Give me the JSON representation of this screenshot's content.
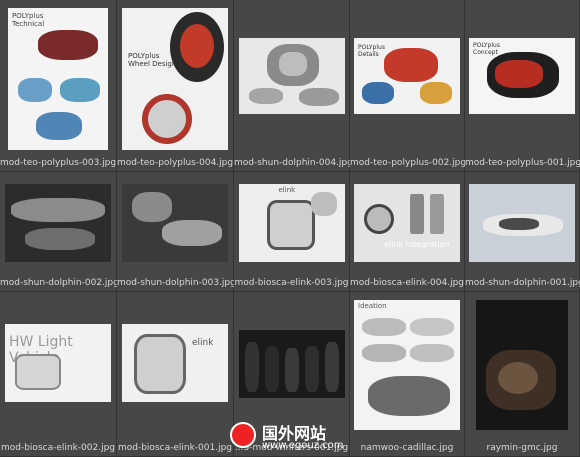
{
  "files": [
    {
      "name": "mod-teo-polyplus-003.jpg",
      "title": "POLYplus Technical",
      "accent": "#d8352a"
    },
    {
      "name": "mod-teo-polyplus-004.jpg",
      "title": "POLYplus Wheel Design",
      "accent": "#c23a28"
    },
    {
      "name": "mod-shun-dolphin-004.jpg",
      "title": "",
      "accent": "#8a8a8a"
    },
    {
      "name": "mod-teo-polyplus-002.jpg",
      "title": "POLYplus Details",
      "accent": "#c33a2a"
    },
    {
      "name": "mod-teo-polyplus-001.jpg",
      "title": "POLYplus Concept",
      "accent": "#b82d22"
    },
    {
      "name": "mod-shun-dolphin-002.jpg",
      "title": "",
      "accent": "#777777"
    },
    {
      "name": "mod-shun-dolphin-003.jpg",
      "title": "",
      "accent": "#7b7b7b"
    },
    {
      "name": "mod-biosca-elink-003.jpg",
      "title": "elink",
      "accent": "#555555"
    },
    {
      "name": "mod-biosca-elink-004.jpg",
      "title": "elink Integration",
      "accent": "#555555"
    },
    {
      "name": "mod-shun-dolphin-001.jpg",
      "title": "",
      "accent": "#9aa3ad"
    },
    {
      "name": "mod-biosca-elink-002.jpg",
      "title": "HW Light Vehicle",
      "accent": "#999999"
    },
    {
      "name": "mod-biosca-elink-001.jpg",
      "title": "elink",
      "accent": "#666666"
    },
    {
      "name": "...3-mod-winners-001.jpg",
      "title": "",
      "accent": "#1a1a1a"
    },
    {
      "name": "namwoo-cadillac.jpg",
      "title": "Ideation",
      "accent": "#666666"
    },
    {
      "name": "raymin-gmc.jpg",
      "title": "",
      "accent": "#1c1c1c"
    }
  ],
  "watermark": {
    "cn": "国外网站",
    "url": "www.egouz.com"
  }
}
